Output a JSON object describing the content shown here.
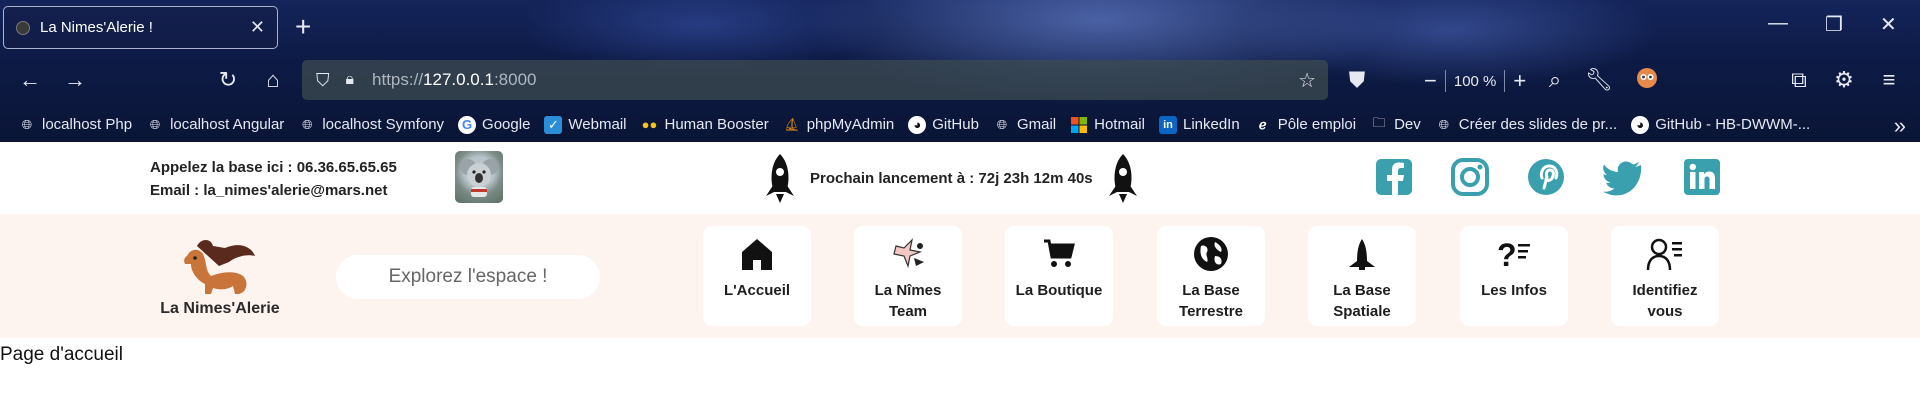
{
  "browser": {
    "tab": {
      "title": "La Nimes'Alerie !"
    },
    "url": {
      "scheme": "https://",
      "host": "127.0.0.1",
      "port": ":8000"
    },
    "zoom": "100 %",
    "bookmarks": [
      {
        "label": "localhost Php",
        "icon": "globe-icon"
      },
      {
        "label": "localhost Angular",
        "icon": "globe-icon"
      },
      {
        "label": "localhost Symfony",
        "icon": "globe-icon"
      },
      {
        "label": "Google",
        "icon": "google-icon"
      },
      {
        "label": "Webmail",
        "icon": "webmail-icon"
      },
      {
        "label": "Human Booster",
        "icon": "human-booster-icon"
      },
      {
        "label": "phpMyAdmin",
        "icon": "phpmyadmin-icon"
      },
      {
        "label": "GitHub",
        "icon": "github-icon"
      },
      {
        "label": "Gmail",
        "icon": "globe-icon"
      },
      {
        "label": "Hotmail",
        "icon": "microsoft-icon"
      },
      {
        "label": "LinkedIn",
        "icon": "linkedin-icon"
      },
      {
        "label": "Pôle emploi",
        "icon": "pole-emploi-icon"
      },
      {
        "label": "Dev",
        "icon": "folder-icon"
      },
      {
        "label": "Créer des slides de pr...",
        "icon": "globe-icon"
      },
      {
        "label": "GitHub - HB-DWWM-...",
        "icon": "github-icon"
      }
    ]
  },
  "topbar": {
    "contact_phone": "Appelez la base ici : 06.36.65.65.65",
    "contact_email": "Email : la_nimes'alerie@mars.net",
    "launch_text": "Prochain lancement à : 72j 23h 12m 40s",
    "social": [
      "facebook-icon",
      "instagram-icon",
      "pinterest-icon",
      "twitter-icon",
      "linkedin-icon"
    ],
    "accent_color": "#3aa0ad"
  },
  "header": {
    "brand": "La Nimes'Alerie",
    "search_placeholder": "Explorez l'espace !",
    "nav": [
      {
        "label": "L'Accueil",
        "icon": "home-icon"
      },
      {
        "label": "La Nîmes Team",
        "icon": "team-icon"
      },
      {
        "label": "La Boutique",
        "icon": "cart-icon"
      },
      {
        "label": "La Base Terrestre",
        "icon": "globe-earth-icon"
      },
      {
        "label": "La Base Spatiale",
        "icon": "shuttle-icon"
      },
      {
        "label": "Les Infos",
        "icon": "question-icon"
      },
      {
        "label": "Identifiez vous",
        "icon": "user-list-icon"
      }
    ]
  },
  "main": {
    "title": "Page d'accueil"
  }
}
